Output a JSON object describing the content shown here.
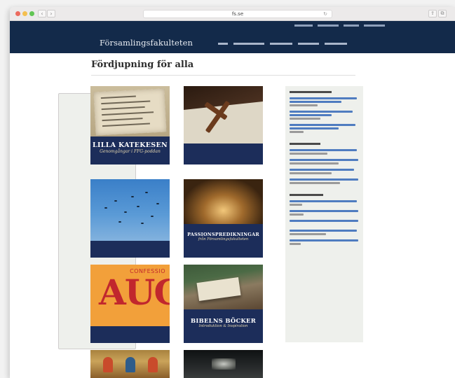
{
  "browser": {
    "url": "fs.se",
    "back_glyph": "‹",
    "forward_glyph": "›",
    "sidebar_glyph": "▥",
    "reload_glyph": "↻",
    "share_glyph": "⇪",
    "tabs_glyph": "⧉"
  },
  "header": {
    "brand": "Församlingsfakulteten",
    "top_links": [
      "",
      "",
      "",
      ""
    ],
    "main_nav": [
      "",
      "",
      "",
      "",
      ""
    ]
  },
  "page": {
    "title": "Fördjupning för alla"
  },
  "tiles": {
    "lilla_katekesen": {
      "title": "LILLA KATEKESEN",
      "subtitle": "Genomgångar i FFG-poddan"
    },
    "evangeliet": {
      "title": "",
      "subtitle": ""
    },
    "kristen_manniska": {
      "title": "",
      "subtitle": ""
    },
    "passionspredikningar": {
      "title": "PASSIONSPREDIKNINGAR",
      "subtitle": "från Församlingsfakulteten"
    },
    "confessio": {
      "badge": "CONFESSIO",
      "monogram": "AUG",
      "title": "",
      "subtitle": ""
    },
    "bibelns_bocker": {
      "title": "BIBELNS BÖCKER",
      "subtitle": "Introduktion & Inspiration"
    }
  },
  "sidebar": {
    "groups": [
      {
        "heading": "",
        "items": [
          {
            "link": "",
            "date": ""
          },
          {
            "link": "",
            "date": ""
          },
          {
            "link": "",
            "date": ""
          }
        ]
      },
      {
        "heading": "",
        "items": [
          {
            "link": "",
            "date": ""
          },
          {
            "link": "",
            "date": ""
          },
          {
            "link": "",
            "date": ""
          },
          {
            "link": "",
            "date": ""
          }
        ]
      },
      {
        "heading": "",
        "items": [
          {
            "link": "",
            "date": ""
          },
          {
            "link": "",
            "date": ""
          },
          {
            "link": "",
            "date": ""
          },
          {
            "link": "",
            "date": ""
          },
          {
            "link": "",
            "date": ""
          }
        ]
      }
    ]
  }
}
